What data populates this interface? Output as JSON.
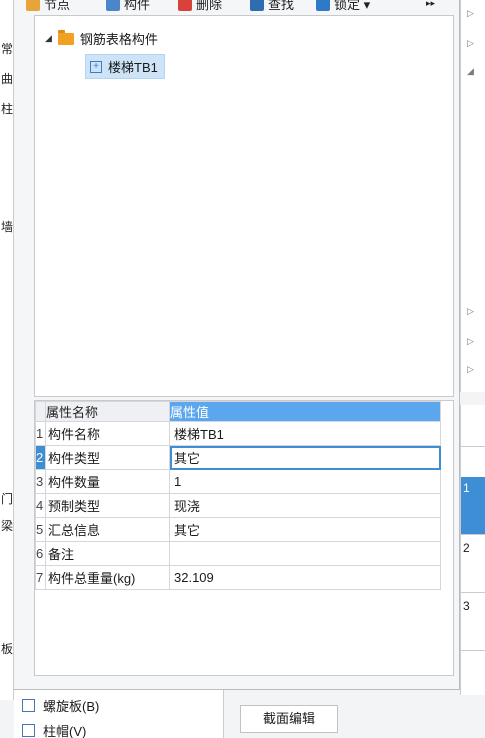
{
  "toolbar": {
    "items": [
      "节点",
      "构件",
      "删除",
      "查找",
      "锁定 ▾"
    ],
    "more": "▸▸"
  },
  "left_strip": {
    "chars": [
      "常",
      "曲",
      "柱",
      "墙",
      "门",
      "梁",
      "板"
    ]
  },
  "tree": {
    "root_label": "钢筋表格构件",
    "child_label": "楼梯TB1"
  },
  "properties": {
    "header_name": "属性名称",
    "header_value": "属性值",
    "rows": [
      {
        "idx": "1",
        "name": "构件名称",
        "value": "楼梯TB1"
      },
      {
        "idx": "2",
        "name": "构件类型",
        "value": "其它"
      },
      {
        "idx": "3",
        "name": "构件数量",
        "value": "1"
      },
      {
        "idx": "4",
        "name": "预制类型",
        "value": "现浇"
      },
      {
        "idx": "5",
        "name": "汇总信息",
        "value": "其它"
      },
      {
        "idx": "6",
        "name": "备注",
        "value": ""
      },
      {
        "idx": "7",
        "name": "构件总重量(kg)",
        "value": "32.109"
      }
    ]
  },
  "right_panel": {
    "rows": [
      "1",
      "2",
      "3"
    ]
  },
  "footer": {
    "list_item": "螺旋板(B)",
    "list_item2": "柱帽(V)",
    "button": "截面编辑"
  },
  "colors": {
    "accent": "#3e8ed6",
    "header_blue": "#5aa7ef",
    "selection": "#cde3f7",
    "folder": "#f0a022"
  }
}
